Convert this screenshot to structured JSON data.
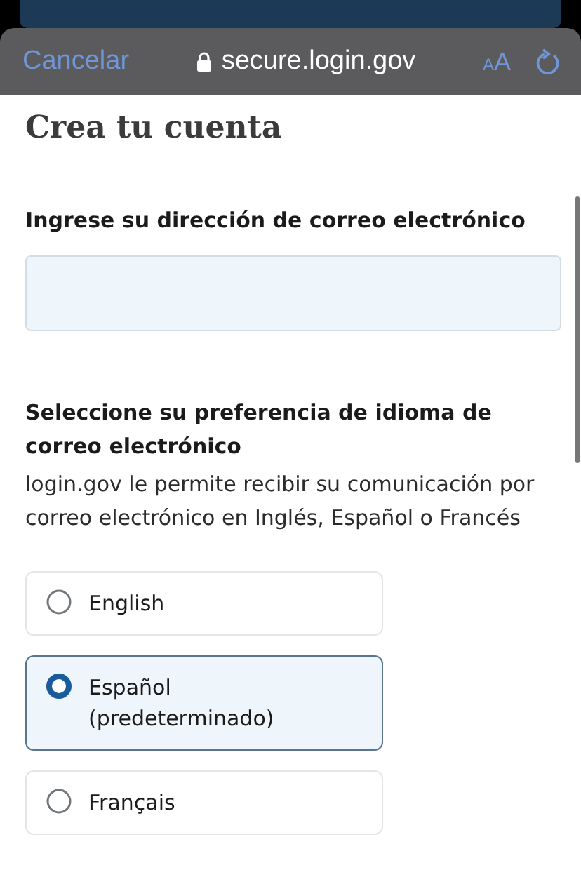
{
  "browser_bar": {
    "cancel": "Cancelar",
    "url": "secure.login.gov",
    "text_size": "AA"
  },
  "title": "Crea tu cuenta",
  "email_field": {
    "label": "Ingrese su dirección de correo electrónico"
  },
  "language": {
    "heading": "Seleccione su preferencia de idioma de correo electrónico",
    "description": "login.gov le permite recibir su comunicación por correo electrónico en Inglés, Español o Francés",
    "options": [
      {
        "label": "English",
        "selected": false
      },
      {
        "label": "Español (predeterminado)",
        "selected": true
      },
      {
        "label": "Français",
        "selected": false
      }
    ]
  }
}
